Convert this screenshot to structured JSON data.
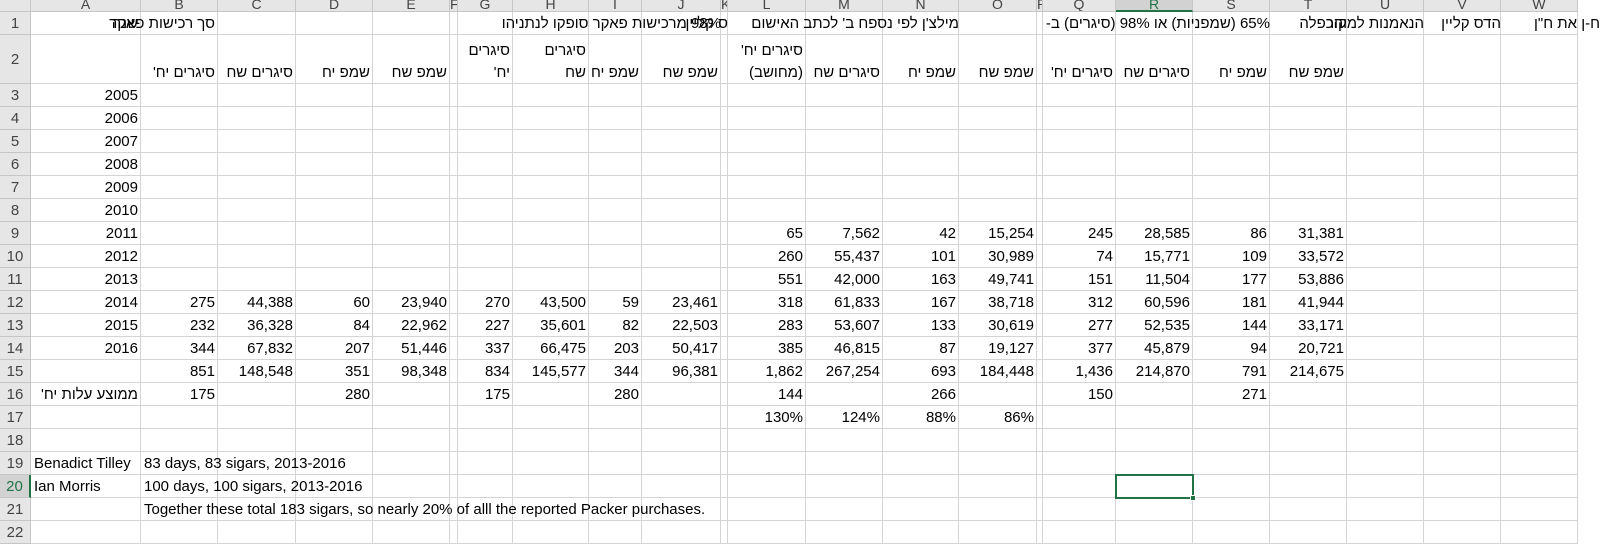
{
  "sheet": {
    "columns": [
      "A",
      "B",
      "C",
      "D",
      "E",
      "F",
      "G",
      "H",
      "I",
      "J",
      "K",
      "L",
      "M",
      "N",
      "O",
      "P",
      "Q",
      "R",
      "S",
      "T",
      "U",
      "V",
      "W"
    ],
    "rows": [
      "1",
      "2",
      "3",
      "4",
      "5",
      "6",
      "7",
      "8",
      "9",
      "10",
      "11",
      "12",
      "13",
      "14",
      "15",
      "16",
      "17",
      "18",
      "19",
      "20",
      "21",
      "22"
    ],
    "selected_cell": "R20",
    "colors": {
      "accent": "#217346",
      "gridline": "#d4d4d4",
      "header_bg": "#e6e6e6"
    },
    "headers": {
      "B1": "סך רכישות פאקר",
      "A1": "שנה",
      "G1": "98% מרכישות פאקר סופקו לנתניהו",
      "K1": "ס קליין",
      "L1": "מילצ'ן לפי נספח ב' לכתב האישום",
      "Q1": "65% (שמפניות) או 98% (סיגרים) ב-",
      "T1": "והכפלה",
      "U1": "הנאמנות למקור",
      "V1": "הדס קליין",
      "W1": "ח-ן את ח\"ן"
    },
    "subheaders": {
      "B2": "סיגרים יח'",
      "C2": "סיגרים שח",
      "D2": "שמפ יח",
      "E2": "שמפ שח",
      "G2a": "סיגרים",
      "G2b": "יח'",
      "H2a": "סיגרים",
      "H2b": "שח",
      "I2": "שמפ יח",
      "J2": "שמפ שח",
      "L2a": "סיגרים יח'",
      "L2b": "(מחושב)",
      "M2": "סיגרים שח",
      "N2": "שמפ יח",
      "O2": "שמפ שח",
      "Q2": "סיגרים יח'",
      "R2": "סיגרים שח",
      "S2": "שמפ יח",
      "T2": "שמפ שח"
    },
    "years": [
      "2005",
      "2006",
      "2007",
      "2008",
      "2009",
      "2010",
      "2011",
      "2012",
      "2013",
      "2014",
      "2015",
      "2016"
    ],
    "data_rows": {
      "r9": {
        "L": "65",
        "M": "7,562",
        "N": "42",
        "O": "15,254",
        "Q": "245",
        "R": "28,585",
        "S": "86",
        "T": "31,381"
      },
      "r10": {
        "L": "260",
        "M": "55,437",
        "N": "101",
        "O": "30,989",
        "Q": "74",
        "R": "15,771",
        "S": "109",
        "T": "33,572"
      },
      "r11": {
        "L": "551",
        "M": "42,000",
        "N": "163",
        "O": "49,741",
        "Q": "151",
        "R": "11,504",
        "S": "177",
        "T": "53,886"
      },
      "r12": {
        "B": "275",
        "C": "44,388",
        "D": "60",
        "E": "23,940",
        "G": "270",
        "H": "43,500",
        "I": "59",
        "J": "23,461",
        "L": "318",
        "M": "61,833",
        "N": "167",
        "O": "38,718",
        "Q": "312",
        "R": "60,596",
        "S": "181",
        "T": "41,944"
      },
      "r13": {
        "B": "232",
        "C": "36,328",
        "D": "84",
        "E": "22,962",
        "G": "227",
        "H": "35,601",
        "I": "82",
        "J": "22,503",
        "L": "283",
        "M": "53,607",
        "N": "133",
        "O": "30,619",
        "Q": "277",
        "R": "52,535",
        "S": "144",
        "T": "33,171"
      },
      "r14": {
        "B": "344",
        "C": "67,832",
        "D": "207",
        "E": "51,446",
        "G": "337",
        "H": "66,475",
        "I": "203",
        "J": "50,417",
        "L": "385",
        "M": "46,815",
        "N": "87",
        "O": "19,127",
        "Q": "377",
        "R": "45,879",
        "S": "94",
        "T": "20,721"
      },
      "r15": {
        "B": "851",
        "C": "148,548",
        "D": "351",
        "E": "98,348",
        "G": "834",
        "H": "145,577",
        "I": "344",
        "J": "96,381",
        "L": "1,862",
        "M": "267,254",
        "N": "693",
        "O": "184,448",
        "Q": "1,436",
        "R": "214,870",
        "S": "791",
        "T": "214,675"
      },
      "r16": {
        "A": "ממוצע עלות יח'",
        "B": "175",
        "D": "280",
        "G": "175",
        "I": "280",
        "L": "144",
        "N": "266",
        "Q": "150",
        "S": "271"
      },
      "r17": {
        "L": "130%",
        "M": "124%",
        "N": "88%",
        "O": "86%"
      }
    },
    "notes": {
      "A19": "Benadict Tilley",
      "B19": "83 days, 83 sigars, 2013-2016",
      "A20": "Ian Morris",
      "B20": "100 days, 100 sigars, 2013-2016",
      "B21": "Together these total 183 sigars, so nearly 20% of alll the reported Packer purchases."
    }
  }
}
